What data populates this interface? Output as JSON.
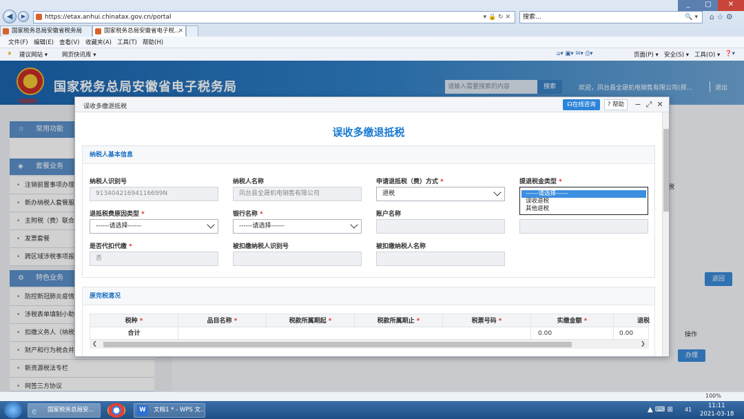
{
  "browser": {
    "url": "https://etax.anhui.chinatax.gov.cn/portal",
    "search_placeholder": "搜索...",
    "tabs": [
      {
        "label": "国家税务总局安徽省税务局"
      },
      {
        "label": "国家税务总局安徽省电子税..."
      }
    ],
    "menu": [
      "文件(F)",
      "编辑(E)",
      "查看(V)",
      "收藏夹(A)",
      "工具(T)",
      "帮助(H)"
    ],
    "favorites": [
      "建议网站 ▾",
      "网页快讯库 ▾"
    ],
    "toolbar_right": [
      "页面(P) ▾",
      "安全(S) ▾",
      "工具(O) ▾"
    ],
    "zoom": "100%"
  },
  "portal": {
    "title": "国家税务总局安徽省电子税务局",
    "search_placeholder": "请输入需要搜索的内容",
    "search_button": "搜索",
    "welcome": "欢迎，凤台县全晟机电销售有限公司(郑...",
    "logout": "退出"
  },
  "sidebar": {
    "sections": [
      {
        "label": "常用功能"
      },
      {
        "label": "套餐业务"
      },
      {
        "label": "特色业务"
      }
    ],
    "items_a": [
      "注销前置事项办理",
      "新办纳税人套餐服务",
      "主附税（费）联合申报",
      "发票套餐",
      "跨区域涉税事项报验"
    ],
    "items_b": [
      "防控新冠肺炎疫情",
      "涉税表单填制小助手",
      "扣缴义务人（纳税）",
      "财产和行为税合并申报",
      "新资源税法专栏",
      "网签三方协议"
    ]
  },
  "behind": {
    "back_button": "返回",
    "operate_header": "操作",
    "handle_button": "办理",
    "side_text": "税"
  },
  "modal": {
    "title": "误收多缴退抵税",
    "online_button": "在线咨询",
    "help_button": "帮助",
    "form_title": "误收多缴退抵税",
    "section1": "纳税人基本信息",
    "fields": {
      "taxpayer_id_label": "纳税人识别号",
      "taxpayer_id_value": "91340421694116699N",
      "taxpayer_name_label": "纳税人名称",
      "taxpayer_name_value": "凤台县全晟机电销售有限公司",
      "method_label": "申请退抵税（费）方式",
      "method_value": "退税",
      "refund_type_label": "提退税金类型",
      "refund_type_options": [
        "------请选择------",
        "误收退税",
        "其他退税"
      ],
      "reason_label": "退抵税费原因类型",
      "reason_value": "------请选择------",
      "bank_label": "银行名称",
      "bank_value": "------请选择------",
      "account_label": "账户名称",
      "account_value": "",
      "withhold_label": "是否代扣代缴",
      "withhold_value": "否",
      "withheld_id_label": "被扣缴纳税人识别号",
      "withheld_id_value": "",
      "withheld_name_label": "被扣缴纳税人名称",
      "withheld_name_value": ""
    },
    "section2": "原完税清况",
    "table": {
      "headers": [
        "税种",
        "品目名称",
        "税款所属期起",
        "税款所属期止",
        "税票号码",
        "实缴金额",
        "退税"
      ],
      "total_label": "合计",
      "total_amount_1": "0.00",
      "total_amount_2": "0.00"
    }
  },
  "taskbar": {
    "tasks": [
      "国家税务总局安...",
      "文档1 * - WPS 文..."
    ],
    "time": "11:11",
    "date": "2021-03-18",
    "badge": "41"
  },
  "colors": {
    "accent": "#1b7ad1",
    "required": "#d9332b",
    "header_blue": "#2f7fc6"
  }
}
